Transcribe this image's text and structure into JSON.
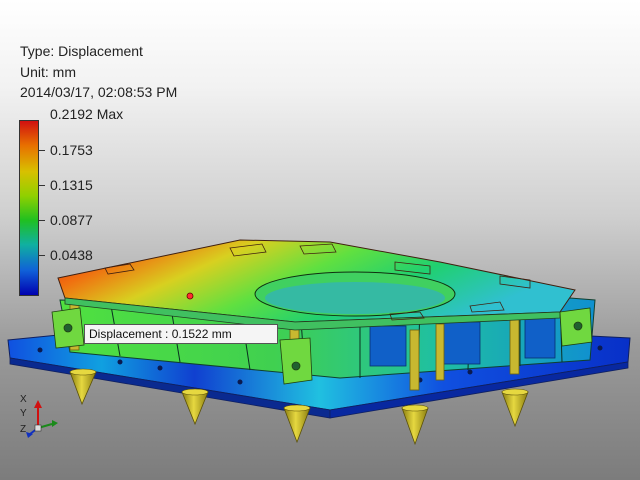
{
  "result_info": {
    "type_line": "Type: Displacement",
    "unit_line": "Unit: mm",
    "timestamp_line": "2014/03/17, 02:08:53 PM"
  },
  "legend": {
    "max_label": "0.2192 Max",
    "ticks": [
      {
        "value": "0.1753"
      },
      {
        "value": "0.1315"
      },
      {
        "value": "0.0877"
      },
      {
        "value": "0.0438"
      }
    ],
    "colors": [
      "#d01010",
      "#e87000",
      "#d8c000",
      "#90d000",
      "#20c020",
      "#10b0a0",
      "#1060d8",
      "#0000b0"
    ]
  },
  "probe": {
    "label": "Displacement : 0.1522 mm"
  },
  "triad": {
    "x": "X",
    "y": "Y",
    "z": "Z"
  },
  "colors": {
    "support_cone": "#d4c428",
    "highlight_probe": "#ff3030"
  }
}
